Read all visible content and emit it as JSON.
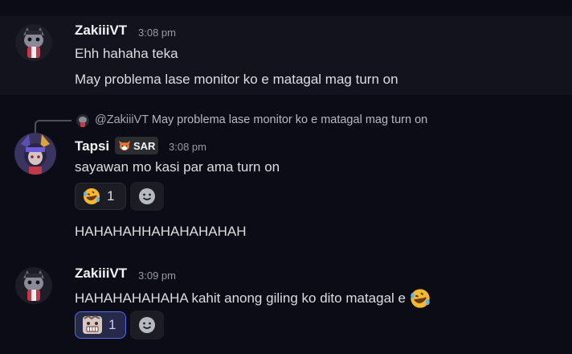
{
  "messages": [
    {
      "author": "ZakiiiVT",
      "time": "3:08 pm",
      "lines": [
        "Ehh hahaha teka",
        "May problema lase monitor ko e  matagal mag turn on"
      ]
    },
    {
      "reply": {
        "mention": "@ZakiiiVT",
        "text": "May problema lase monitor ko e  matagal mag turn on"
      },
      "author": "Tapsi",
      "tag": "SAR",
      "time": "3:08 pm",
      "lines": [
        "sayawan mo kasi par ama turn on"
      ],
      "reaction": {
        "emoji": "rolling-on-floor-laughing",
        "count": "1"
      },
      "after_reaction_line": "HAHAHAHHAHAHAHAHAH"
    },
    {
      "author": "ZakiiiVT",
      "time": "3:09 pm",
      "lines": [
        "HAHAHAHAHAHA kahit anong giling ko dito matagal e"
      ],
      "trailing_emoji": "rolling-on-floor-laughing",
      "reaction": {
        "emoji": "custom-grimace-emote",
        "count": "1",
        "active": true
      }
    }
  ],
  "colors": {
    "background": "#0c0c16",
    "highlight": "#13131d",
    "reaction_active_border": "#5865f2"
  }
}
